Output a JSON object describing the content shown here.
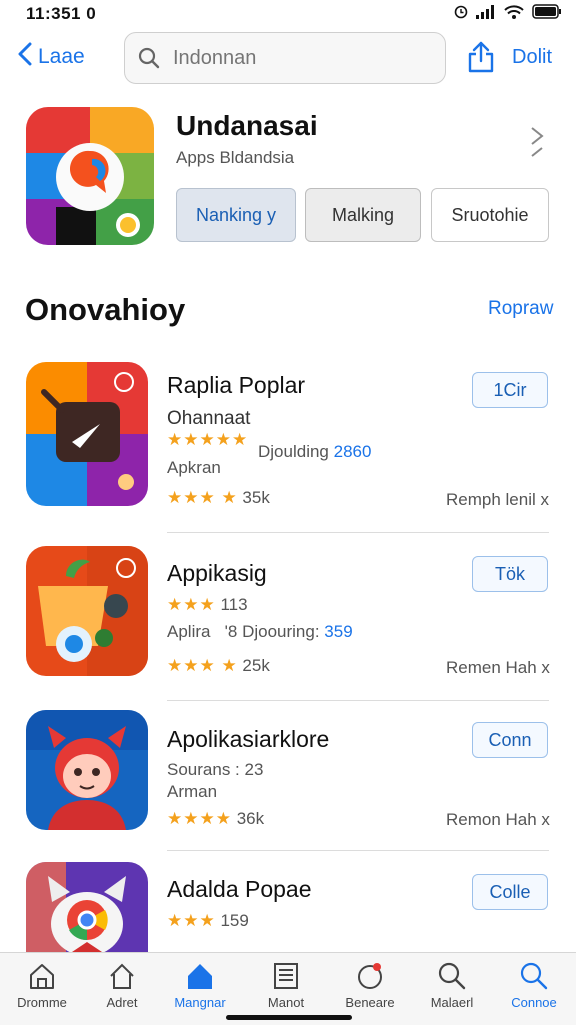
{
  "status": {
    "time": "11:351 0"
  },
  "nav": {
    "back_label": "Laae",
    "search_placeholder": "Indonnan",
    "done_label": "Dolit"
  },
  "hero": {
    "title": "Undanasai",
    "subtitle": "Apps Bldandsia",
    "chips": [
      "Nanking y",
      "Malking",
      "Sruotohie"
    ]
  },
  "section": {
    "title": "Onovahioy",
    "link": "Ropraw"
  },
  "apps": [
    {
      "name": "Raplia Poplar",
      "line1": "Ohannaat",
      "stars1": "★★★★★",
      "extra_label": "Djoulding",
      "extra_value": "2860",
      "line2": "Apkran",
      "stars2": "★★★ ★",
      "count": "35k",
      "button": "1Cir",
      "rank": "Remph lenil x"
    },
    {
      "name": "Appikasig",
      "stars1": "★★★",
      "count1": "113",
      "line2": "Aplira",
      "extra_label": "'8 Djoouring:",
      "extra_value": "359",
      "stars2": "★★★ ★",
      "count": "25k",
      "button": "Tök",
      "rank": "Remen Hah x"
    },
    {
      "name": "Apolikasiarklore",
      "line1": "Sourans : 23",
      "line2": "Arman",
      "stars2": "★★★★",
      "count": "36k",
      "button": "Conn",
      "rank": "Remon Hah x"
    },
    {
      "name": "Adalda Popae",
      "stars1": "★★★",
      "count1": "159",
      "button": "Colle"
    }
  ],
  "tabs": [
    "Dromme",
    "Adret",
    "Mangnar",
    "Manot",
    "Beneare",
    "Malaerl",
    "Connoe"
  ],
  "colors": {
    "accent": "#1a73e8",
    "star": "#f4a11d"
  }
}
